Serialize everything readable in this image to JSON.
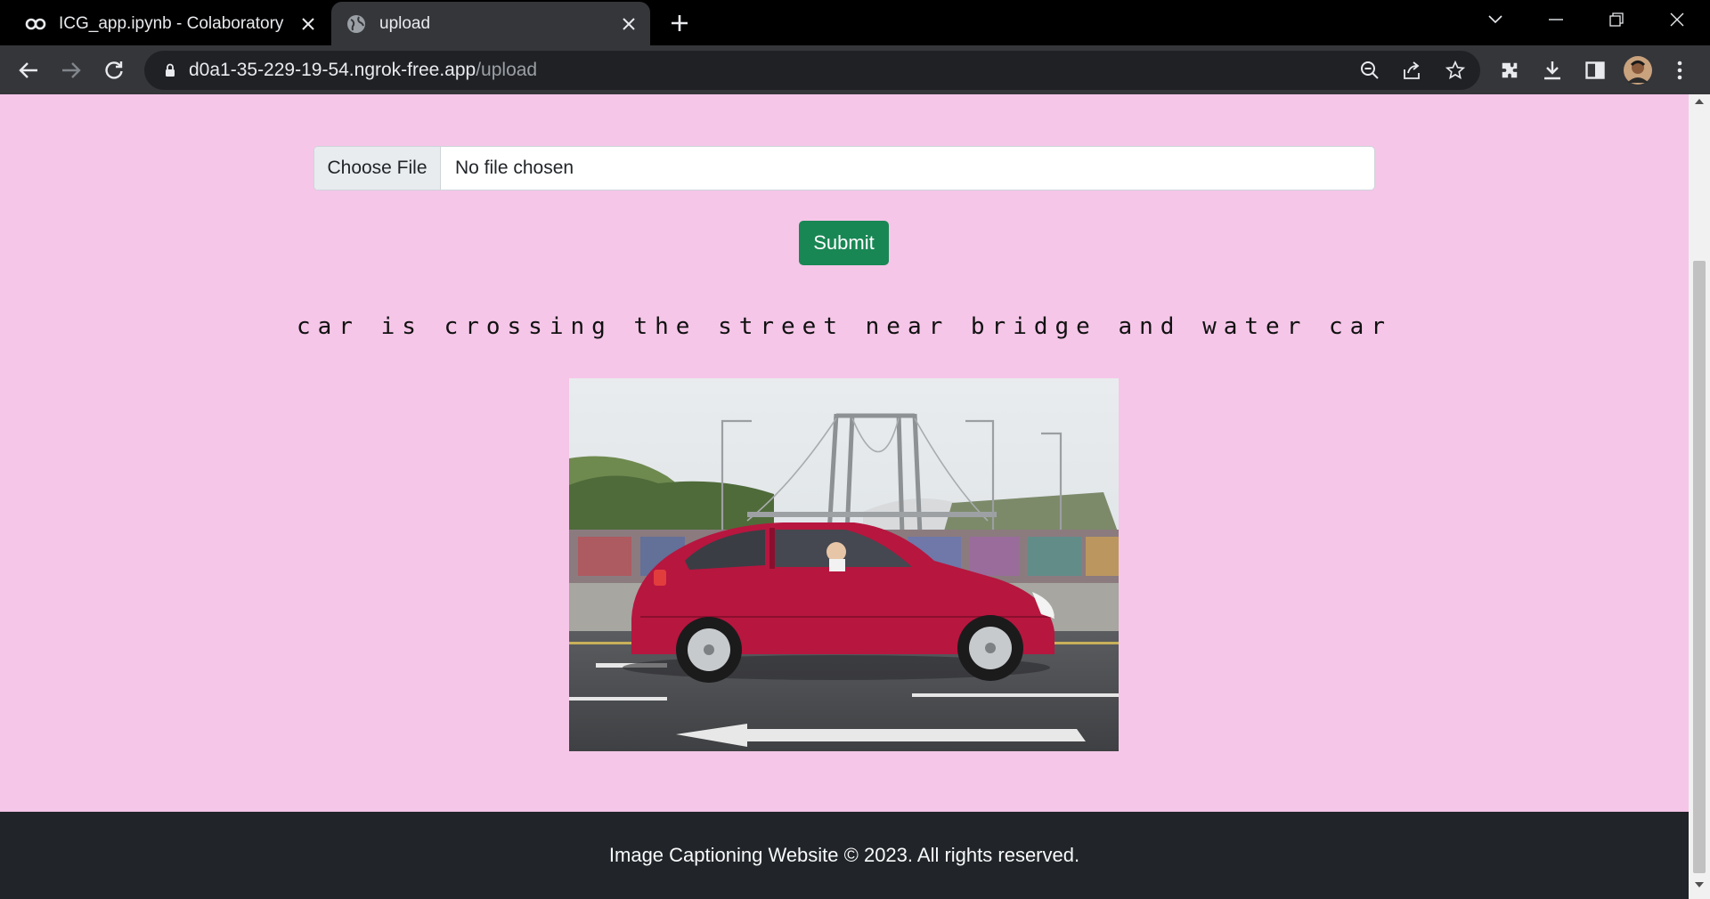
{
  "browser": {
    "tabs": [
      {
        "title": "ICG_app.ipynb - Colaboratory",
        "icon": "colab-icon",
        "active": false
      },
      {
        "title": "upload",
        "icon": "globe-icon",
        "active": true
      }
    ],
    "url": {
      "host": "d0a1-35-229-19-54.ngrok-free.app",
      "path": "/upload"
    }
  },
  "page": {
    "file_button": "Choose File",
    "file_status": "No file chosen",
    "submit_label": "Submit",
    "caption": "car is crossing the street near bridge and water car",
    "image_alt": "red hatchback car on street near suspension bridge",
    "footer": "Image Captioning Website © 2023. All rights reserved."
  },
  "colors": {
    "page_background": "#f5c6e8",
    "submit_button": "#198754",
    "footer_background": "#212529"
  }
}
